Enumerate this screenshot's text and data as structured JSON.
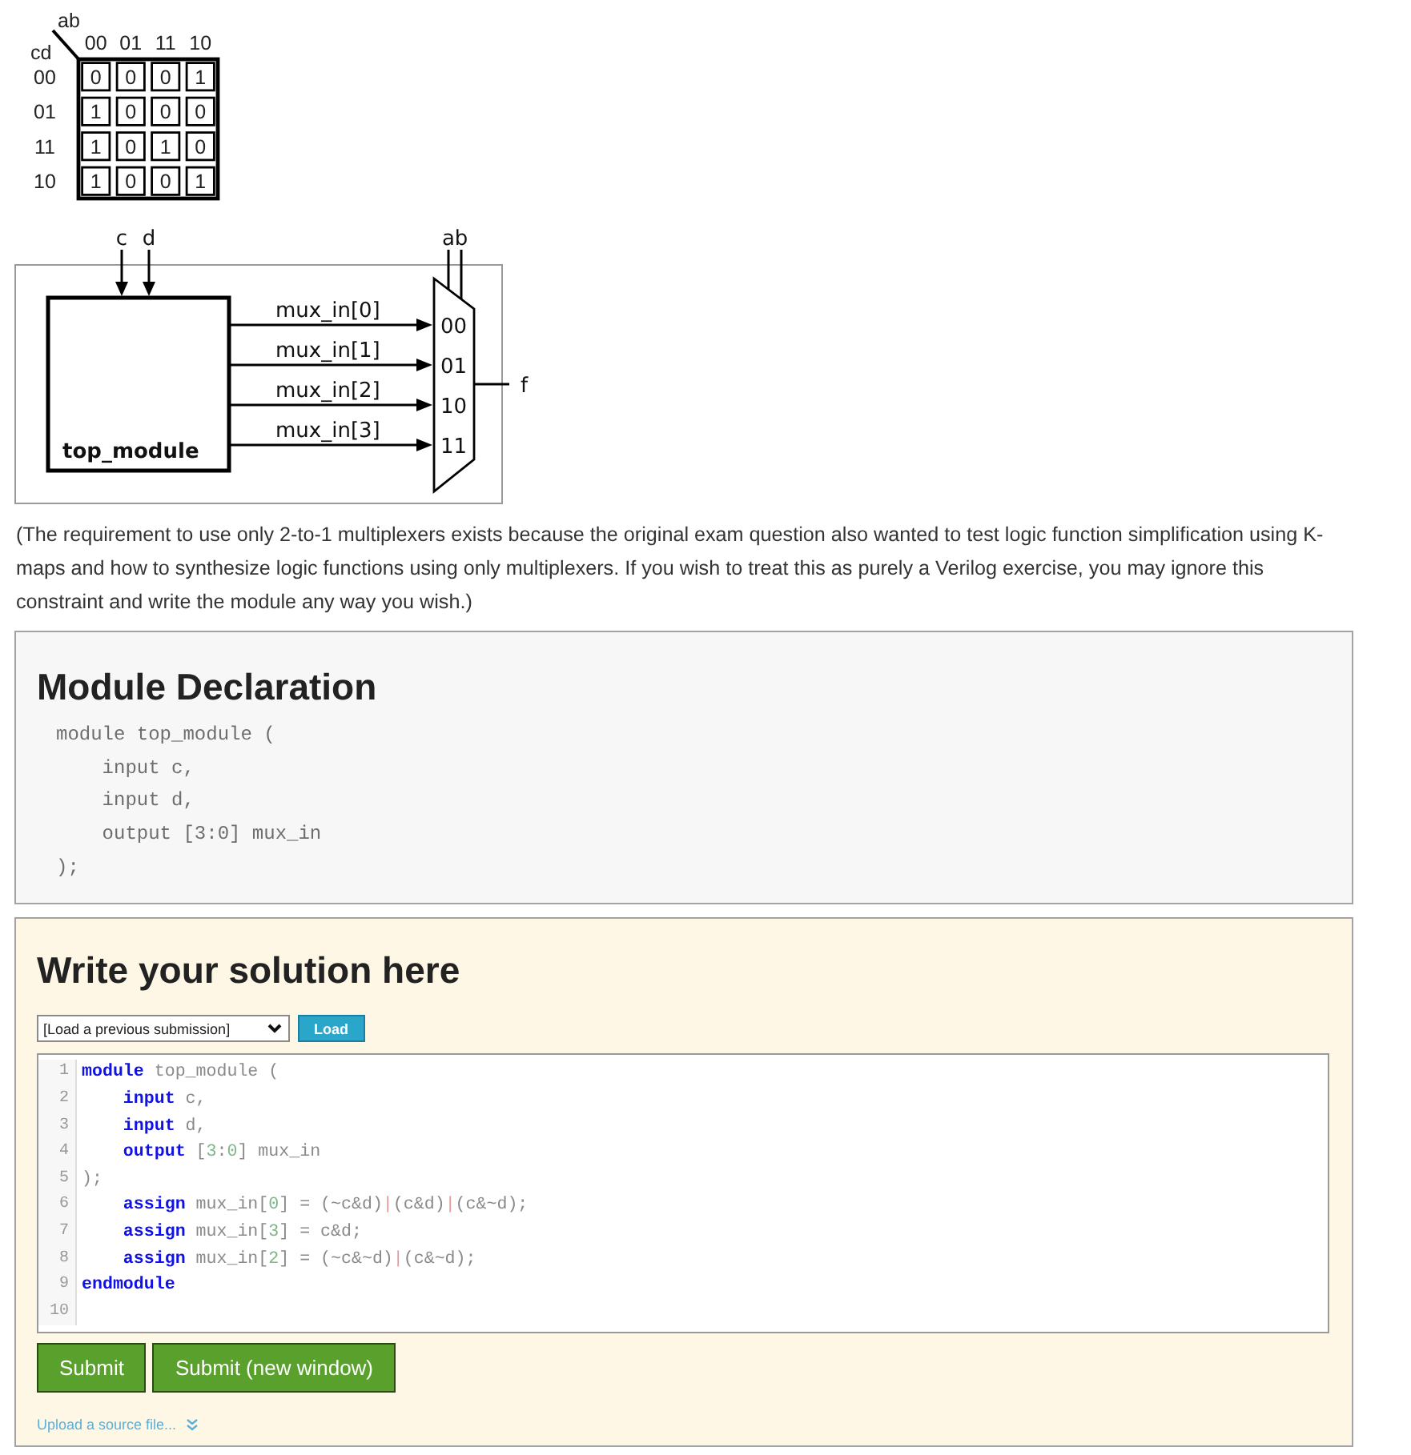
{
  "kmap": {
    "column_variables": "ab",
    "row_variables": "cd",
    "columns": [
      "00",
      "01",
      "11",
      "10"
    ],
    "rows": [
      {
        "label": "00",
        "cells": [
          "0",
          "0",
          "0",
          "1"
        ]
      },
      {
        "label": "01",
        "cells": [
          "1",
          "0",
          "0",
          "0"
        ]
      },
      {
        "label": "11",
        "cells": [
          "1",
          "0",
          "1",
          "0"
        ]
      },
      {
        "label": "10",
        "cells": [
          "1",
          "0",
          "0",
          "1"
        ]
      }
    ]
  },
  "diagram": {
    "inputs": [
      "c",
      "d"
    ],
    "selects": [
      "a",
      "b"
    ],
    "block_label": "top_module",
    "signals": [
      {
        "label": "mux_in[0]",
        "port": "00"
      },
      {
        "label": "mux_in[1]",
        "port": "01"
      },
      {
        "label": "mux_in[2]",
        "port": "10"
      },
      {
        "label": "mux_in[3]",
        "port": "11"
      }
    ],
    "output": "f"
  },
  "note": "(The requirement to use only 2-to-1 multiplexers exists because the original exam question also wanted to test logic function simplification using K-maps and how to synthesize logic functions using only multiplexers. If you wish to treat this as purely a Verilog exercise, you may ignore this constraint and write the module any way you wish.)",
  "declaration": {
    "title": "Module Declaration",
    "code": [
      "module top_module (",
      "    input c,",
      "    input d,",
      "    output [3:0] mux_in",
      ");"
    ]
  },
  "solution": {
    "title": "Write your solution here",
    "dropdown": "[Load a previous submission]",
    "load_button": "Load",
    "editor": [
      {
        "number": "1",
        "tokens": [
          {
            "kind": "keyword",
            "text": "module"
          },
          {
            "kind": "text",
            "text": " top_module ("
          }
        ]
      },
      {
        "number": "2",
        "tokens": [
          {
            "kind": "keyword",
            "text": "    input"
          },
          {
            "kind": "text",
            "text": " c,"
          }
        ]
      },
      {
        "number": "3",
        "tokens": [
          {
            "kind": "keyword",
            "text": "    input"
          },
          {
            "kind": "text",
            "text": " d,"
          }
        ]
      },
      {
        "number": "4",
        "tokens": [
          {
            "kind": "keyword",
            "text": "    output"
          },
          {
            "kind": "text",
            "text": " ["
          },
          {
            "kind": "number",
            "text": "3"
          },
          {
            "kind": "text",
            "text": ":"
          },
          {
            "kind": "number",
            "text": "0"
          },
          {
            "kind": "text",
            "text": "] mux_in"
          }
        ]
      },
      {
        "number": "5",
        "tokens": [
          {
            "kind": "text",
            "text": ");"
          }
        ]
      },
      {
        "number": "6",
        "tokens": [
          {
            "kind": "keyword",
            "text": "    assign"
          },
          {
            "kind": "text",
            "text": " mux_in["
          },
          {
            "kind": "number",
            "text": "0"
          },
          {
            "kind": "text",
            "text": "] = (~c&d)"
          },
          {
            "kind": "operator",
            "text": "|"
          },
          {
            "kind": "text",
            "text": "(c&d)"
          },
          {
            "kind": "operator",
            "text": "|"
          },
          {
            "kind": "text",
            "text": "(c&~d);"
          }
        ]
      },
      {
        "number": "7",
        "tokens": [
          {
            "kind": "keyword",
            "text": "    assign"
          },
          {
            "kind": "text",
            "text": " mux_in["
          },
          {
            "kind": "number",
            "text": "3"
          },
          {
            "kind": "text",
            "text": "] = c&d;"
          }
        ]
      },
      {
        "number": "8",
        "tokens": [
          {
            "kind": "keyword",
            "text": "    assign"
          },
          {
            "kind": "text",
            "text": " mux_in["
          },
          {
            "kind": "number",
            "text": "2"
          },
          {
            "kind": "text",
            "text": "] = (~c&~d)"
          },
          {
            "kind": "operator",
            "text": "|"
          },
          {
            "kind": "text",
            "text": "(c&~d);"
          }
        ]
      },
      {
        "number": "9",
        "tokens": [
          {
            "kind": "keyword",
            "text": "endmodule"
          }
        ]
      },
      {
        "number": "10"
      }
    ],
    "buttons": [
      "Submit",
      "Submit (new window)"
    ],
    "upload_link": "Upload a source file..."
  }
}
